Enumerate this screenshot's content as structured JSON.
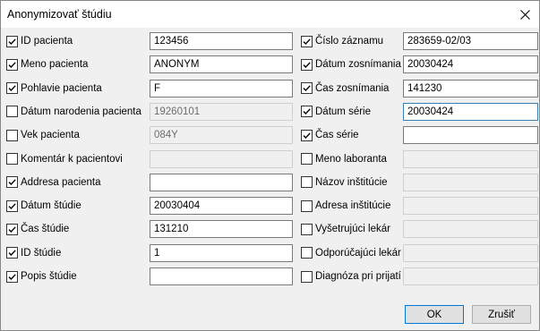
{
  "window": {
    "title": "Anonymizovať štúdiu"
  },
  "left_rows": [
    {
      "label": "ID pacienta",
      "checked": true,
      "value": "123456",
      "disabled": false
    },
    {
      "label": "Meno pacienta",
      "checked": true,
      "value": "ANONYM",
      "disabled": false
    },
    {
      "label": "Pohlavie pacienta",
      "checked": true,
      "value": "F",
      "disabled": false
    },
    {
      "label": "Dátum narodenia pacienta",
      "checked": false,
      "value": "19260101",
      "disabled": true
    },
    {
      "label": "Vek pacienta",
      "checked": false,
      "value": "084Y",
      "disabled": true
    },
    {
      "label": "Komentár k pacientovi",
      "checked": false,
      "value": "",
      "disabled": true
    },
    {
      "label": "Addresa pacienta",
      "checked": true,
      "value": "",
      "disabled": false
    },
    {
      "label": "Dátum štúdie",
      "checked": true,
      "value": "20030404",
      "disabled": false
    },
    {
      "label": "Čas štúdie",
      "checked": true,
      "value": "131210",
      "disabled": false
    },
    {
      "label": "ID štúdie",
      "checked": true,
      "value": "1",
      "disabled": false
    },
    {
      "label": "Popis štúdie",
      "checked": true,
      "value": "",
      "disabled": false
    }
  ],
  "right_rows": [
    {
      "label": "Číslo záznamu",
      "checked": true,
      "value": "283659-02/03",
      "disabled": false
    },
    {
      "label": "Dátum zosnímania",
      "checked": true,
      "value": "20030424",
      "disabled": false
    },
    {
      "label": "Čas zosnímania",
      "checked": true,
      "value": "141230",
      "disabled": false
    },
    {
      "label": "Dátum série",
      "checked": true,
      "value": "20030424",
      "disabled": false,
      "focused": true
    },
    {
      "label": "Čas série",
      "checked": true,
      "value": "",
      "disabled": false
    },
    {
      "label": "Meno laboranta",
      "checked": false,
      "value": "",
      "disabled": true
    },
    {
      "label": "Názov inštitúcie",
      "checked": false,
      "value": "",
      "disabled": true
    },
    {
      "label": "Adresa inštitúcie",
      "checked": false,
      "value": "",
      "disabled": true
    },
    {
      "label": "Vyšetrujúci lekár",
      "checked": false,
      "value": "",
      "disabled": true
    },
    {
      "label": "Odporúčajúci lekár",
      "checked": false,
      "value": "",
      "disabled": true
    },
    {
      "label": "Diagnóza pri prijatí",
      "checked": false,
      "value": "",
      "disabled": true
    }
  ],
  "buttons": {
    "ok_label": "OK",
    "cancel_label": "Zrušiť"
  },
  "colors": {
    "focus_border": "#3c7fb1",
    "default_button_border": "#0078d7"
  }
}
